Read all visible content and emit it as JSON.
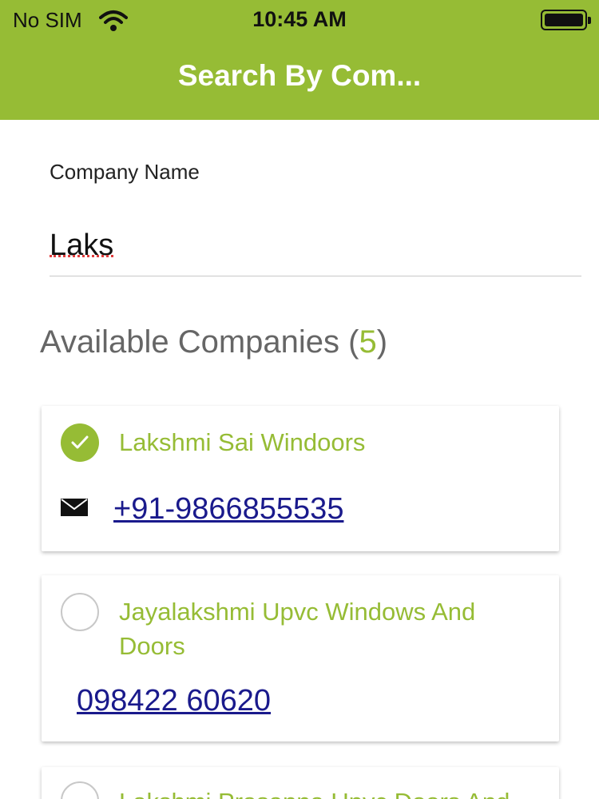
{
  "status_bar": {
    "carrier": "No SIM",
    "time": "10:45 AM",
    "icons": [
      "wifi-icon",
      "battery-icon"
    ]
  },
  "nav": {
    "title": "Search By Com..."
  },
  "search": {
    "label": "Company Name",
    "value": "Laks"
  },
  "results": {
    "heading": "Available Companies",
    "count_open": "(",
    "count": "5",
    "count_close": ")",
    "companies": [
      {
        "name": "Lakshmi Sai Windoors",
        "phone": "+91-9866855535",
        "selected": true,
        "icon": "mail-icon"
      },
      {
        "name": "Jayalakshmi Upvc Windows And Doors",
        "phone": "098422 60620",
        "selected": false
      },
      {
        "name": "Lakshmi Prasanna Upvc Doors And",
        "selected": false
      }
    ]
  },
  "colors": {
    "accent": "#96bc35",
    "link": "#1a1a8c",
    "heading_gray": "#666666"
  }
}
